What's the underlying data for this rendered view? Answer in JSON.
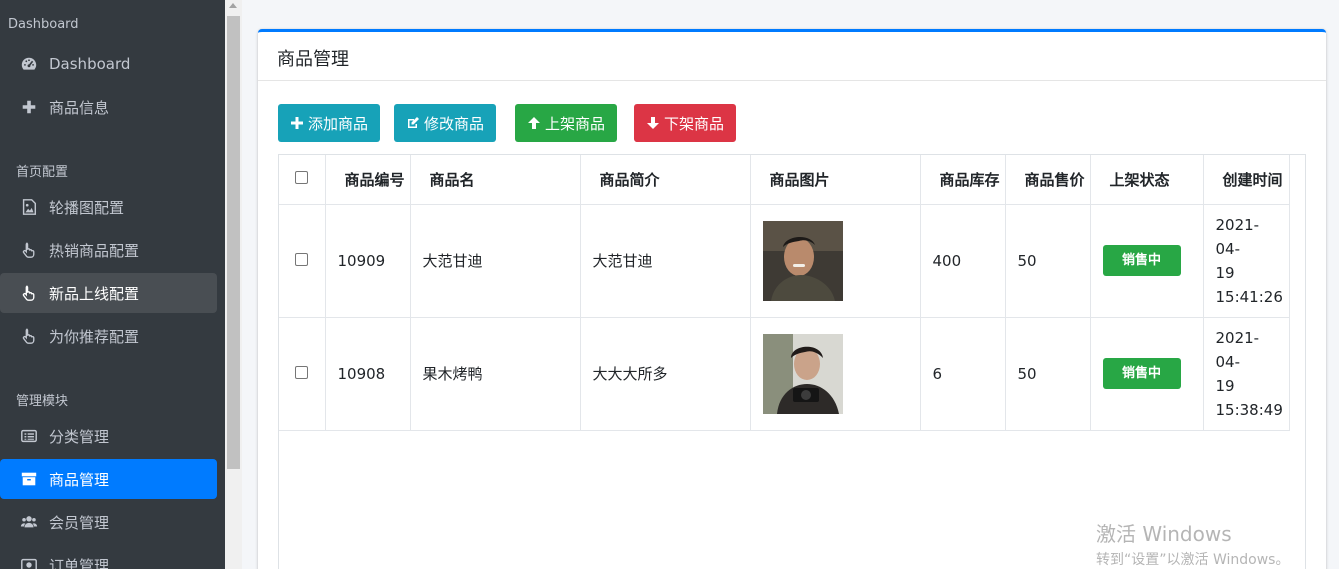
{
  "sidebar": {
    "header": "Dashboard",
    "sections": [
      "首页配置",
      "管理模块"
    ],
    "items": [
      {
        "label": "Dashboard",
        "icon": "tachometer-icon"
      },
      {
        "label": "商品信息",
        "icon": "plus-icon"
      },
      {
        "label": "轮播图配置",
        "icon": "image-icon"
      },
      {
        "label": "热销商品配置",
        "icon": "hand-pointer-icon"
      },
      {
        "label": "新品上线配置",
        "icon": "hand-pointer-icon"
      },
      {
        "label": "为你推荐配置",
        "icon": "hand-pointer-icon"
      },
      {
        "label": "分类管理",
        "icon": "list-alt-icon"
      },
      {
        "label": "商品管理",
        "icon": "archive-icon"
      },
      {
        "label": "会员管理",
        "icon": "users-icon"
      },
      {
        "label": "订单管理",
        "icon": "order-icon"
      }
    ]
  },
  "card": {
    "title": "商品管理",
    "buttons": {
      "add": "添加商品",
      "edit": "修改商品",
      "on_shelf": "上架商品",
      "off_shelf": "下架商品"
    }
  },
  "table": {
    "headers": [
      "商品编号",
      "商品名",
      "商品简介",
      "商品图片",
      "商品库存",
      "商品售价",
      "上架状态",
      "创建时间"
    ],
    "rows": [
      {
        "id": "10909",
        "name": "大范甘迪",
        "intro": "大范甘迪",
        "stock": "400",
        "price": "50",
        "status": "销售中",
        "created_date": "2021-04-",
        "created_day": "19",
        "created_time": "15:41:26"
      },
      {
        "id": "10908",
        "name": "果木烤鸭",
        "intro": "大大大所多",
        "stock": "6",
        "price": "50",
        "status": "销售中",
        "created_date": "2021-04-",
        "created_day": "19",
        "created_time": "15:38:49"
      }
    ]
  },
  "watermark": {
    "line1": "激活 Windows",
    "line2": "转到“设置”以激活 Windows。"
  },
  "colors": {
    "sidebar_bg": "#343a40",
    "primary": "#007bff",
    "info": "#17a2b8",
    "success": "#28a745",
    "danger": "#dc3545"
  }
}
